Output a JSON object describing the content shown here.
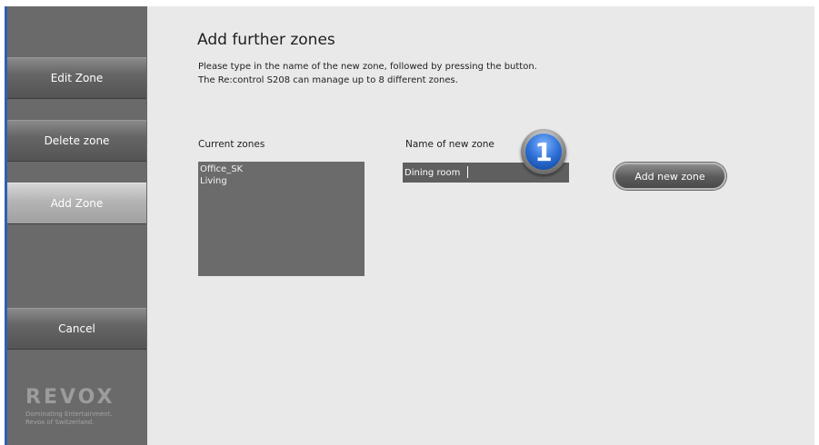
{
  "sidebar": {
    "edit_zone": "Edit Zone",
    "delete_zone": "Delete zone",
    "add_zone": "Add Zone",
    "cancel": "Cancel",
    "logo_text": "REVOX",
    "tagline_1": "Dominating Entertainment.",
    "tagline_2": "Revox of Switzerland."
  },
  "main": {
    "title": "Add further zones",
    "desc_line_1": "Please type in the name of the new zone, followed by pressing the button.",
    "desc_line_2": "The Re:control S208 can manage up to 8 different zones.",
    "current_zones_label": "Current zones",
    "current_zones": [
      "Office_SK",
      "Living"
    ],
    "new_zone_label": "Name of new zone",
    "new_zone_value": "Dining room",
    "step_marker": "1",
    "add_button": "Add new zone"
  },
  "colors": {
    "accent_blue": "#2c6fd6",
    "sidebar_bg": "#6a6a6a",
    "content_bg": "#e9e9e9"
  }
}
